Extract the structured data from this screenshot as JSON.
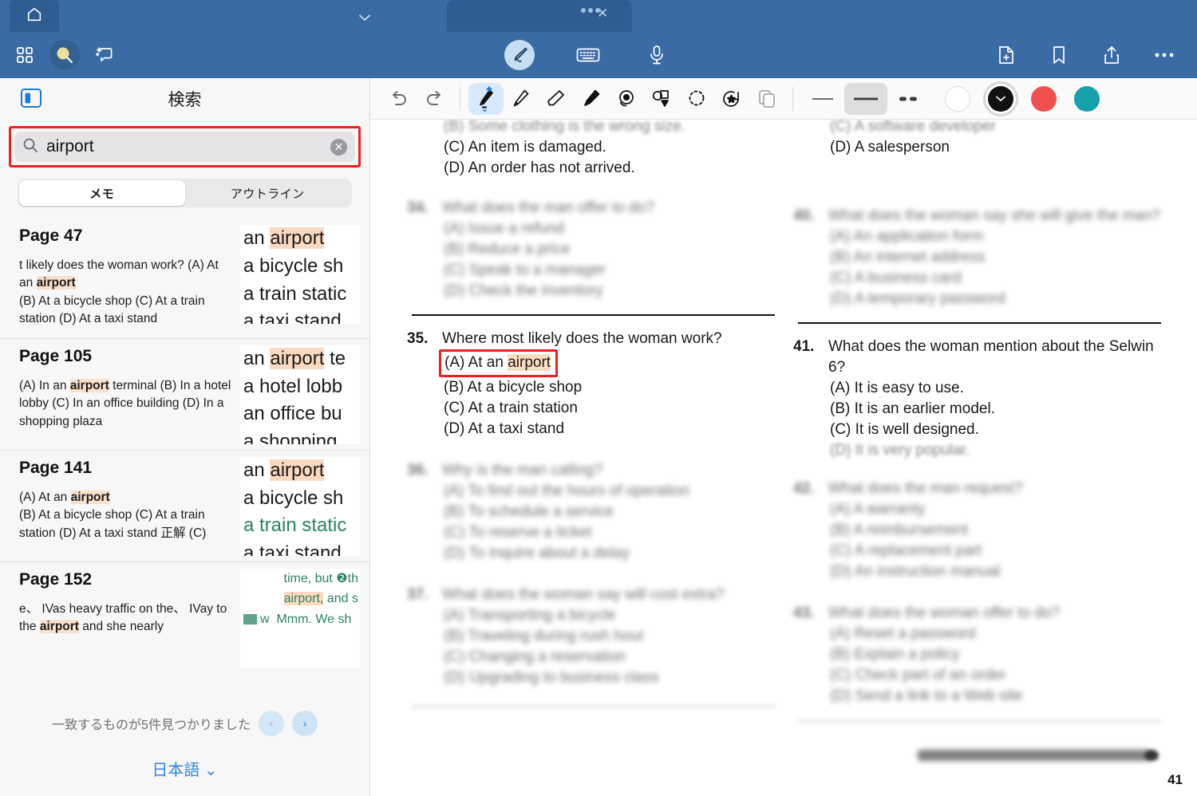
{
  "window": {
    "home_tab_icon": "home-icon",
    "title_chevron_icon": "chevron-down-icon",
    "tab_menu_icon": "more-dots-icon",
    "tab_close_icon": "close-icon"
  },
  "toolbar": {
    "left": [
      {
        "name": "apps-grid-icon",
        "label": ""
      },
      {
        "name": "search-icon",
        "label": ""
      },
      {
        "name": "ai-sparkle-chat-icon",
        "label": ""
      }
    ],
    "center": [
      {
        "name": "pen-annotate-icon",
        "label": ""
      },
      {
        "name": "keyboard-icon",
        "label": ""
      },
      {
        "name": "microphone-icon",
        "label": ""
      }
    ],
    "right": [
      {
        "name": "new-page-icon",
        "label": ""
      },
      {
        "name": "bookmark-icon",
        "label": ""
      },
      {
        "name": "share-icon",
        "label": ""
      },
      {
        "name": "more-options-icon",
        "label": ""
      }
    ]
  },
  "sidebar": {
    "panel_toggle_icon": "sidebar-toggle-icon",
    "title": "検索",
    "search": {
      "value": "airport",
      "placeholder": "検索",
      "icon": "search-icon",
      "clear_icon": "clear-icon",
      "clear_label": "✕"
    },
    "segments": [
      {
        "label": "メモ",
        "active": true
      },
      {
        "label": "アウトライン",
        "active": false
      }
    ],
    "results": [
      {
        "page": "Page 47",
        "snippet_pre": "t likely does the woman work? (A) At an ",
        "snippet_hl": "airport",
        "snippet_post": "(B) At a bicycle shop (C) At a train station (D) At a taxi stand",
        "thumb_lines": [
          "an airport",
          "a bicycle sh",
          "a train static",
          "a taxi stand"
        ]
      },
      {
        "page": "Page 105",
        "snippet_pre": "(A) In an ",
        "snippet_hl": "airport",
        "snippet_post": " terminal (B) In a hotel lobby (C) In an office building (D) In a shopping plaza",
        "thumb_lines": [
          "an airport te",
          "a hotel lobb",
          "an office bu",
          "a shopping"
        ]
      },
      {
        "page": "Page 141",
        "snippet_pre": "(A) At an ",
        "snippet_hl": "airport",
        "snippet_post": "(B) At a bicycle shop (C) At a train station (D) At a taxi stand 正解 (C)",
        "thumb_lines": [
          "an airport",
          "a bicycle sh",
          "a train static",
          "a taxi stand"
        ]
      },
      {
        "page": "Page 152",
        "snippet_pre": "e、 IVas heavy traffic on the、 IVay to the ",
        "snippet_hl": "airport",
        "snippet_post": " and she nearly",
        "thumb_lines": [
          "time, but ❷th",
          "airport, and s",
          "w  Mmm. We sh"
        ]
      }
    ],
    "footer": {
      "count_text": "一致するものが5件見つかりました",
      "prev_label": "‹",
      "next_label": "›",
      "language": "日本語",
      "language_chevron": "⌄"
    }
  },
  "draw_toolbar": {
    "tools": [
      {
        "name": "undo-icon",
        "selected": false
      },
      {
        "name": "redo-icon",
        "selected": false
      },
      {
        "name": "fountain-pen-icon",
        "selected": true
      },
      {
        "name": "pencil-icon",
        "selected": false
      },
      {
        "name": "eraser-icon",
        "selected": false
      },
      {
        "name": "highlighter-icon",
        "selected": false
      },
      {
        "name": "lasso-tape-icon",
        "selected": false
      },
      {
        "name": "shapes-icon",
        "selected": false
      },
      {
        "name": "lasso-select-icon",
        "selected": false
      },
      {
        "name": "sticker-icon",
        "selected": false
      },
      {
        "name": "copy-icon",
        "selected": false
      }
    ],
    "strokes": [
      {
        "name": "stroke-thin",
        "selected": false
      },
      {
        "name": "stroke-medium",
        "selected": true
      },
      {
        "name": "stroke-dotted",
        "selected": false
      }
    ],
    "colors": [
      {
        "name": "color-white",
        "hex": "#ffffff",
        "selected": false
      },
      {
        "name": "color-black",
        "hex": "#111111",
        "selected": true
      },
      {
        "name": "color-red",
        "hex": "#f0504f",
        "selected": false
      },
      {
        "name": "color-teal",
        "hex": "#16a0ab",
        "selected": false
      }
    ]
  },
  "document": {
    "page_number": "41",
    "left_column": {
      "top_options": [
        "(B) Some clothing is the wrong size.",
        "(C) An item is damaged.",
        "(D) An order has not arrived."
      ],
      "blurred_q34": {
        "number": "34.",
        "text": "What does the man offer to do?",
        "options": [
          "(A) Issue a refund",
          "(B) Reduce a price",
          "(C) Speak to a manager",
          "(D) Check the inventory"
        ]
      },
      "question": {
        "number": "35.",
        "text": "Where most likely does the woman work?",
        "options": [
          "(A) At an airport",
          "(B) At a bicycle shop",
          "(C) At a train station",
          "(D) At a taxi stand"
        ],
        "highlight_word": "airport",
        "boxed_option_index": 0
      },
      "blurred_q36": {
        "number": "36.",
        "text": "Why is the man calling?",
        "options": [
          "(A) To find out the hours of operation",
          "(B) To schedule a service",
          "(C) To reserve a ticket",
          "(D) To inquire about a delay"
        ]
      },
      "blurred_q37": {
        "number": "37.",
        "text": "What does the woman say will cost extra?",
        "options": [
          "(A) Transporting a bicycle",
          "(B) Traveling during rush hour",
          "(C) Changing a reservation",
          "(D) Upgrading to business class"
        ]
      }
    },
    "right_column": {
      "top_options": [
        "(C) A software developer",
        "(D) A salesperson"
      ],
      "blurred_q40": {
        "number": "40.",
        "text": "What does the woman say she will give the man?",
        "options": [
          "(A) An application form",
          "(B) An internet address",
          "(C) A business card",
          "(D) A temporary password"
        ]
      },
      "question": {
        "number": "41.",
        "text": "What does the woman mention about the Selwin 6?",
        "options": [
          "(A) It is easy to use.",
          "(B) It is an earlier model.",
          "(C) It is well designed.",
          "(D) It is very popular."
        ]
      },
      "blurred_q42": {
        "number": "42.",
        "text": "What does the man request?",
        "options": [
          "(A) A warranty",
          "(B) A reimbursement",
          "(C) A replacement part",
          "(D) An instruction manual"
        ]
      },
      "blurred_q43": {
        "number": "43.",
        "text": "What does the woman offer to do?",
        "options": [
          "(A) Reset a password",
          "(B) Explain a policy",
          "(C) Check part of an order",
          "(D) Send a link to a Web site"
        ]
      }
    }
  }
}
